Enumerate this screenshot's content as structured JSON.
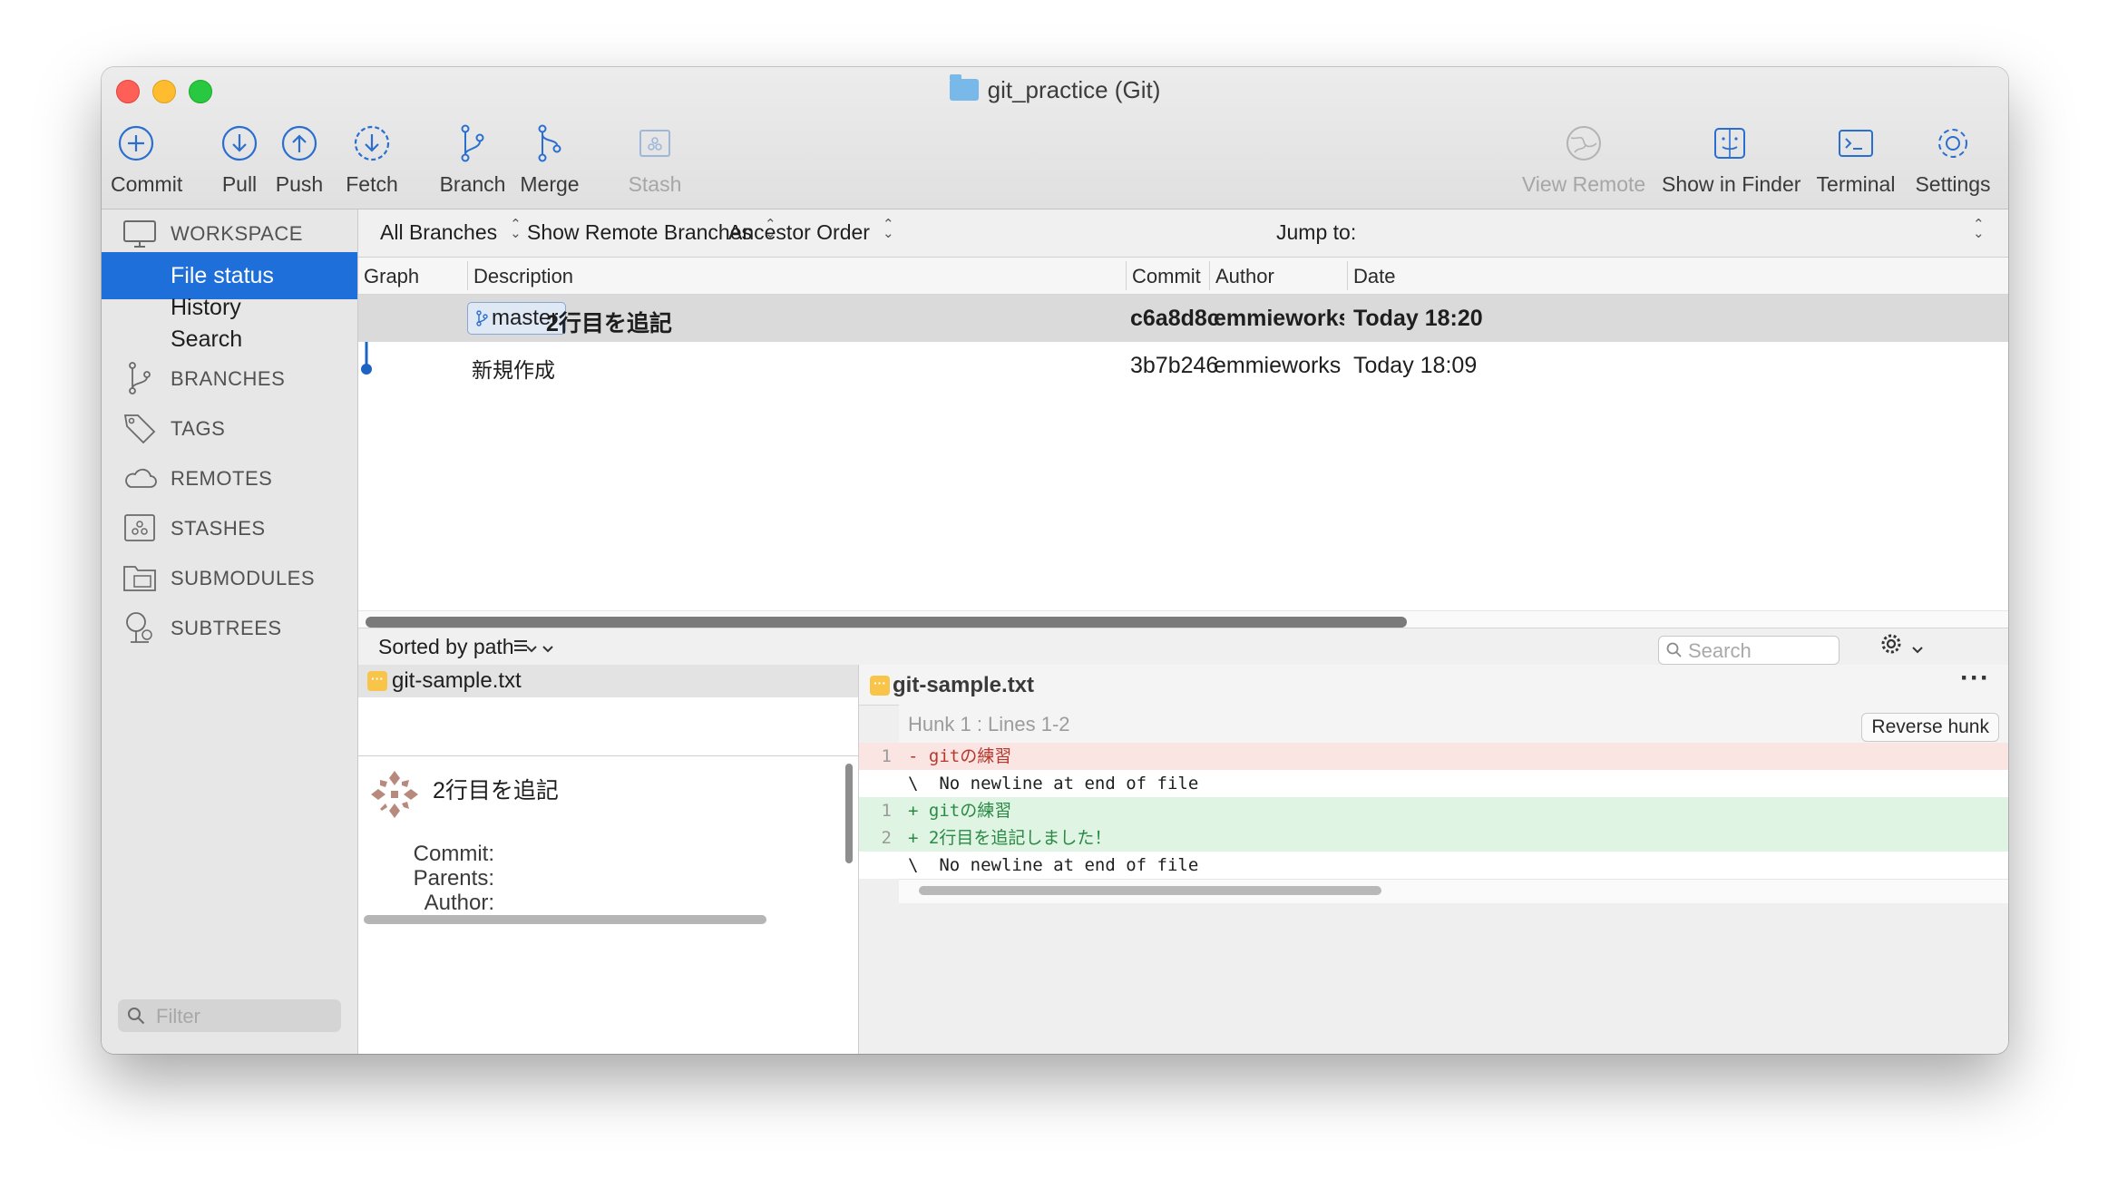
{
  "window": {
    "title": "git_practice (Git)"
  },
  "toolbar": {
    "commit": "Commit",
    "pull": "Pull",
    "push": "Push",
    "fetch": "Fetch",
    "branch": "Branch",
    "merge": "Merge",
    "stash": "Stash",
    "view_remote": "View Remote",
    "show_in_finder": "Show in Finder",
    "terminal": "Terminal",
    "settings": "Settings"
  },
  "sidebar": {
    "workspace": "WORKSPACE",
    "items": [
      "File status",
      "History",
      "Search"
    ],
    "branches": "BRANCHES",
    "tags": "TAGS",
    "remotes": "REMOTES",
    "stashes": "STASHES",
    "submodules": "SUBMODULES",
    "subtrees": "SUBTREES",
    "filter_placeholder": "Filter"
  },
  "filterbar": {
    "all_branches": "All Branches",
    "show_remote": "Show Remote Branches",
    "order": "Ancestor Order",
    "jump_to": "Jump to:"
  },
  "columns": {
    "graph": "Graph",
    "description": "Description",
    "commit": "Commit",
    "author": "Author",
    "date": "Date"
  },
  "commits": [
    {
      "branch": "master",
      "description": "2行目を追記",
      "hash": "c6a8d8c",
      "author": "emmieworks <f...",
      "date": "Today 18:20"
    },
    {
      "branch": "",
      "description": "新規作成",
      "hash": "3b7b246",
      "author": "emmieworks <fill...",
      "date": "Today 18:09"
    }
  ],
  "filebar": {
    "sort": "Sorted by path",
    "search_placeholder": "Search"
  },
  "files": [
    {
      "name": "git-sample.txt"
    }
  ],
  "commit_detail": {
    "message": "2行目を追記",
    "labels": {
      "commit": "Commit:",
      "parents": "Parents:",
      "author": "Author:"
    }
  },
  "diff": {
    "file": "git-sample.txt",
    "hunk": "Hunk 1 : Lines 1-2",
    "reverse": "Reverse hunk",
    "lines": [
      {
        "old": "1",
        "new": "",
        "kind": "del",
        "text": "- gitの練習"
      },
      {
        "old": "",
        "new": "",
        "kind": "plain",
        "text": "\\  No newline at end of file"
      },
      {
        "old": "",
        "new": "1",
        "kind": "add",
        "text": "+ gitの練習"
      },
      {
        "old": "",
        "new": "2",
        "kind": "add",
        "text": "+ 2行目を追記しました！"
      },
      {
        "old": "",
        "new": "",
        "kind": "plain",
        "text": "\\  No newline at end of file"
      }
    ]
  },
  "colors": {
    "accent": "#1e6fd9",
    "graph_line": "#1d63c2",
    "del_text": "#b6382c",
    "add_text": "#2a8a45"
  }
}
